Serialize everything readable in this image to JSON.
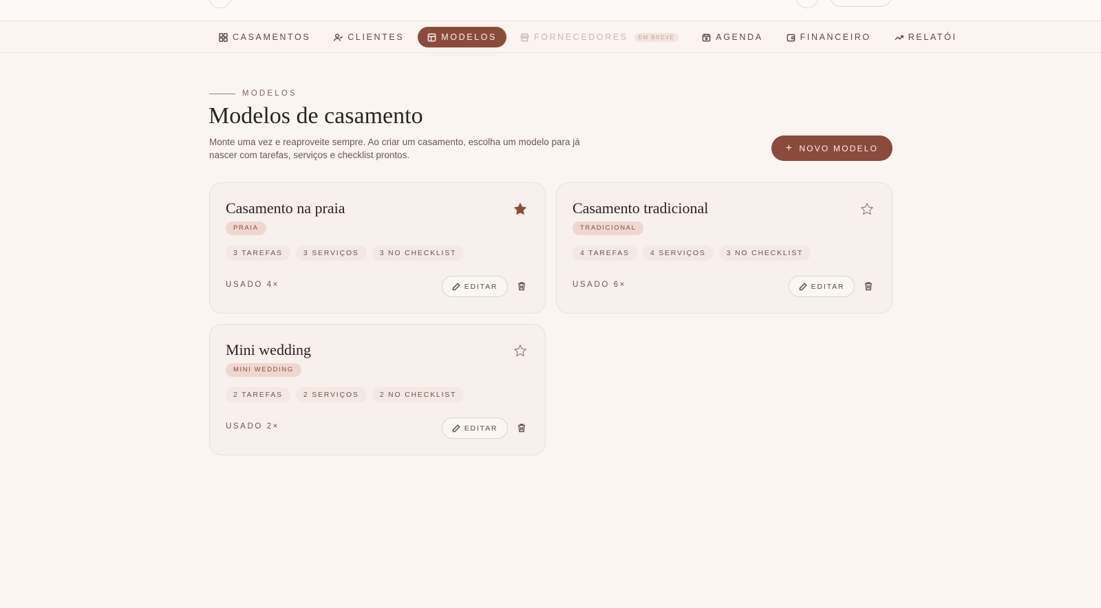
{
  "nav": {
    "items": [
      {
        "label": "CASAMENTOS",
        "icon": "grid-icon",
        "state": "normal"
      },
      {
        "label": "CLIENTES",
        "icon": "users-icon",
        "state": "normal"
      },
      {
        "label": "MODELOS",
        "icon": "template-icon",
        "state": "active"
      },
      {
        "label": "FORNECEDORES",
        "icon": "store-icon",
        "state": "disabled",
        "badge": "EM BREVE"
      },
      {
        "label": "AGENDA",
        "icon": "calendar-icon",
        "state": "normal"
      },
      {
        "label": "FINANCEIRO",
        "icon": "wallet-icon",
        "state": "normal"
      },
      {
        "label": "RELATÓI",
        "icon": "trend-icon",
        "state": "normal"
      }
    ]
  },
  "header": {
    "eyebrow": "MODELOS",
    "title": "Modelos de casamento",
    "description": "Monte uma vez e reaproveite sempre. Ao criar um casamento, escolha um modelo para já nascer com tarefas, serviços e checklist prontos.",
    "new_button": "NOVO MODELO"
  },
  "cards": [
    {
      "title": "Casamento na praia",
      "tag": "PRAIA",
      "favorite": true,
      "stats": [
        "3 TAREFAS",
        "3 SERVIÇOS",
        "3 NO CHECKLIST"
      ],
      "usage": "USADO 4×",
      "edit_label": "EDITAR"
    },
    {
      "title": "Casamento tradicional",
      "tag": "TRADICIONAL",
      "favorite": false,
      "stats": [
        "4 TAREFAS",
        "4 SERVIÇOS",
        "3 NO CHECKLIST"
      ],
      "usage": "USADO 6×",
      "edit_label": "EDITAR"
    },
    {
      "title": "Mini wedding",
      "tag": "MINI WEDDING",
      "favorite": false,
      "stats": [
        "2 TAREFAS",
        "2 SERVIÇOS",
        "2 NO CHECKLIST"
      ],
      "usage": "USADO 2×",
      "edit_label": "EDITAR"
    }
  ],
  "colors": {
    "accent": "#8a4b3c",
    "background": "#fbf5f2",
    "card": "#f8f0ec",
    "tag_bg": "#efd7d1"
  }
}
